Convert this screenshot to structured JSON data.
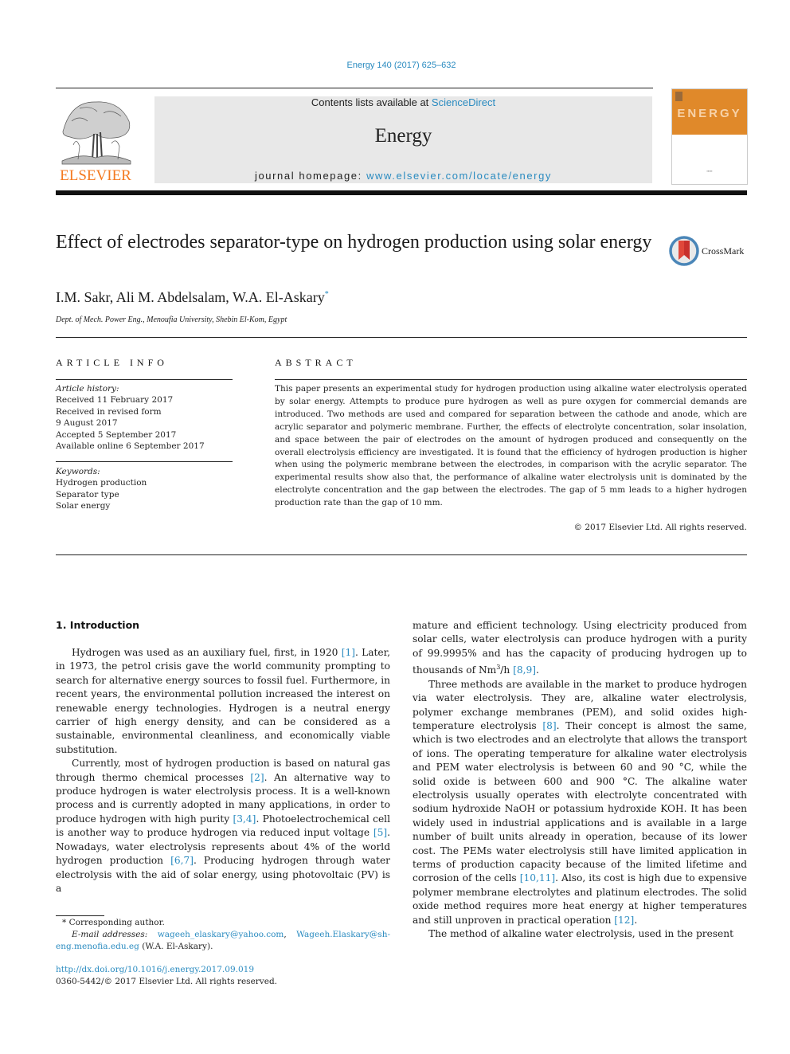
{
  "header": {
    "journal_ref": "Energy 140 (2017) 625–632",
    "contents_prefix": "Contents lists available at ",
    "contents_link": "ScienceDirect",
    "journal_name": "Energy",
    "homepage_prefix": "journal homepage: ",
    "homepage_link": "www.elsevier.com/locate/energy",
    "publisher_logo_text": "ELSEVIER",
    "cover_title": "ENERGY",
    "crossmark_label": "CrossMark",
    "colors": {
      "link": "#2a8bc0",
      "elsevier_orange": "#f47920",
      "cover_orange": "#e0892a",
      "banner_gray": "#e8e8e8"
    }
  },
  "article": {
    "title": "Effect of electrodes separator-type on hydrogen production using solar energy",
    "authors": "I.M. Sakr, Ali M. Abdelsalam, W.A. El-Askary",
    "corresponding_mark": "*",
    "affiliation": "Dept. of Mech. Power Eng., Menoufia University, Shebin El-Kom, Egypt"
  },
  "article_info": {
    "heading": "ARTICLE INFO",
    "history_label": "Article history:",
    "history": [
      "Received 11 February 2017",
      "Received in revised form",
      "9 August 2017",
      "Accepted 5 September 2017",
      "Available online 6 September 2017"
    ],
    "keywords_label": "Keywords:",
    "keywords": [
      "Hydrogen production",
      "Separator type",
      "Solar energy"
    ]
  },
  "abstract": {
    "heading": "ABSTRACT",
    "text": "This paper presents an experimental study for hydrogen production using alkaline water electrolysis operated by solar energy. Attempts to produce pure hydrogen as well as pure oxygen for commercial demands are introduced. Two methods are used and compared for separation between the cathode and anode, which are acrylic separator and polymeric membrane. Further, the effects of electrolyte concentration, solar insolation, and space between the pair of electrodes on the amount of hydrogen produced and consequently on the overall electrolysis efficiency are investigated. It is found that the efficiency of hydrogen production is higher when using the polymeric membrane between the electrodes, in comparison with the acrylic separator. The experimental results show also that, the performance of alkaline water electrolysis unit is dominated by the electrolyte concentration and the gap between the electrodes. The gap of 5 mm leads to a higher hydrogen production rate than the gap of 10 mm.",
    "copyright": "© 2017 Elsevier Ltd. All rights reserved."
  },
  "introduction": {
    "heading": "1.  Introduction",
    "left_paragraphs": [
      [
        {
          "t": "Hydrogen was used as an auxiliary fuel, first, in 1920 "
        },
        {
          "ref": "[1]"
        },
        {
          "t": ". Later, in 1973, the petrol crisis gave the world community prompting to search for alternative energy sources to fossil fuel. Furthermore, in recent years, the environmental pollution increased the interest on renewable energy technologies. Hydrogen is a neutral energy carrier of high energy density, and can be considered as a sustainable, environmental cleanliness, and economically viable substitution."
        }
      ],
      [
        {
          "t": "Currently, most of hydrogen production is based on natural gas through thermo chemical processes "
        },
        {
          "ref": "[2]"
        },
        {
          "t": ". An alternative way to produce hydrogen is water electrolysis process. It is a well-known process and is currently adopted in many applications, in order to produce hydrogen with high purity "
        },
        {
          "ref": "[3,4]"
        },
        {
          "t": ". Photoelectrochemical cell is another way to produce hydrogen via reduced input voltage "
        },
        {
          "ref": "[5]"
        },
        {
          "t": ". Nowadays, water electrolysis represents about 4% of the world hydrogen production "
        },
        {
          "ref": "[6,7]"
        },
        {
          "t": ". Producing hydrogen through water electrolysis with the aid of solar energy, using photovoltaic (PV) is a"
        }
      ]
    ],
    "right_paragraphs": [
      [
        {
          "t": "mature and efficient technology. Using electricity produced from solar cells, water electrolysis can produce hydrogen with a purity of 99.9995% and has the capacity of producing hydrogen up to thousands of Nm"
        },
        {
          "sup": "3"
        },
        {
          "t": "/h "
        },
        {
          "ref": "[8,9]"
        },
        {
          "t": "."
        }
      ],
      [
        {
          "t": "Three methods are available in the market to produce hydrogen via water electrolysis. They are, alkaline water electrolysis, polymer exchange membranes (PEM), and solid oxides high-temperature electrolysis "
        },
        {
          "ref": "[8]"
        },
        {
          "t": ". Their concept is almost the same, which is two electrodes and an electrolyte that allows the transport of ions. The operating temperature for alkaline water electrolysis and PEM water electrolysis is between 60 and 90 °C, while the solid oxide is between 600 and 900 °C. The alkaline water electrolysis usually operates with electrolyte concentrated with sodium hydroxide NaOH or potassium hydroxide KOH. It has been widely used in industrial applications and is available in a large number of built units already in operation, because of its lower cost. The PEMs water electrolysis still have limited application in terms of production capacity because of the limited lifetime and corrosion of the cells "
        },
        {
          "ref": "[10,11]"
        },
        {
          "t": ". Also, its cost is high due to expensive polymer membrane electrolytes and platinum electrodes. The solid oxide method requires more heat energy at higher temperatures and still unproven in practical operation "
        },
        {
          "ref": "[12]"
        },
        {
          "t": "."
        }
      ],
      [
        {
          "t": "The method of alkaline water electrolysis, used in the present"
        }
      ]
    ]
  },
  "footnote": {
    "mark": "*",
    "corresponding": "Corresponding author.",
    "email_label": "E-mail addresses:",
    "email_1": "wageeh_elaskary@yahoo.com",
    "email_2": "Wageeh.Elaskary@sh-eng.menofia.edu.eg",
    "email_owner": "(W.A. El-Askary)."
  },
  "footer": {
    "doi": "http://dx.doi.org/10.1016/j.energy.2017.09.019",
    "issn": "0360-5442/© 2017 Elsevier Ltd. All rights reserved."
  }
}
